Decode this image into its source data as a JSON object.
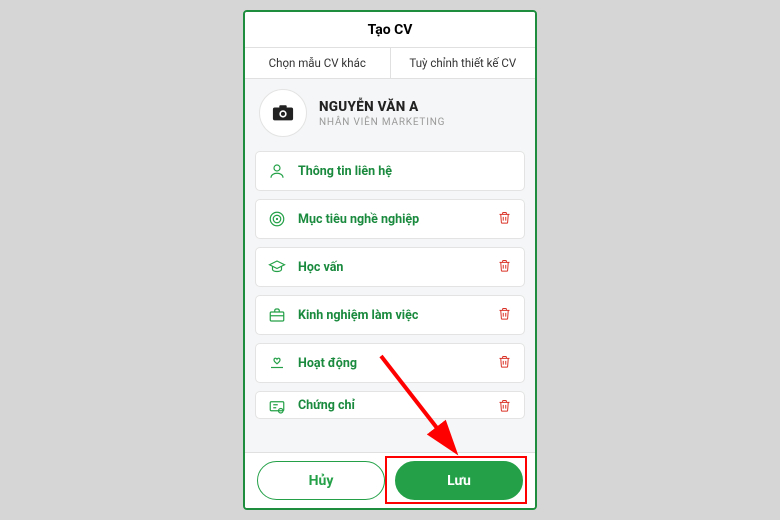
{
  "colors": {
    "brand": "#24a148",
    "danger": "#d93025",
    "highlight": "#ff0000"
  },
  "title": "Tạo CV",
  "tabs": {
    "choose_template": "Chọn mẫu CV khác",
    "customize": "Tuỳ chỉnh thiết kế CV"
  },
  "profile": {
    "name": "NGUYỄN VĂN A",
    "role": "NHÂN VIÊN MARKETING"
  },
  "sections": [
    {
      "icon": "person-icon",
      "label": "Thông tin liên hệ",
      "deletable": false
    },
    {
      "icon": "target-icon",
      "label": "Mục tiêu nghề nghiệp",
      "deletable": true
    },
    {
      "icon": "graduation-icon",
      "label": "Học vấn",
      "deletable": true
    },
    {
      "icon": "briefcase-icon",
      "label": "Kinh nghiệm làm việc",
      "deletable": true
    },
    {
      "icon": "heart-hand-icon",
      "label": "Hoạt động",
      "deletable": true
    },
    {
      "icon": "certificate-icon",
      "label": "Chứng chỉ",
      "deletable": true
    }
  ],
  "footer": {
    "cancel": "Hủy",
    "save": "Lưu"
  }
}
